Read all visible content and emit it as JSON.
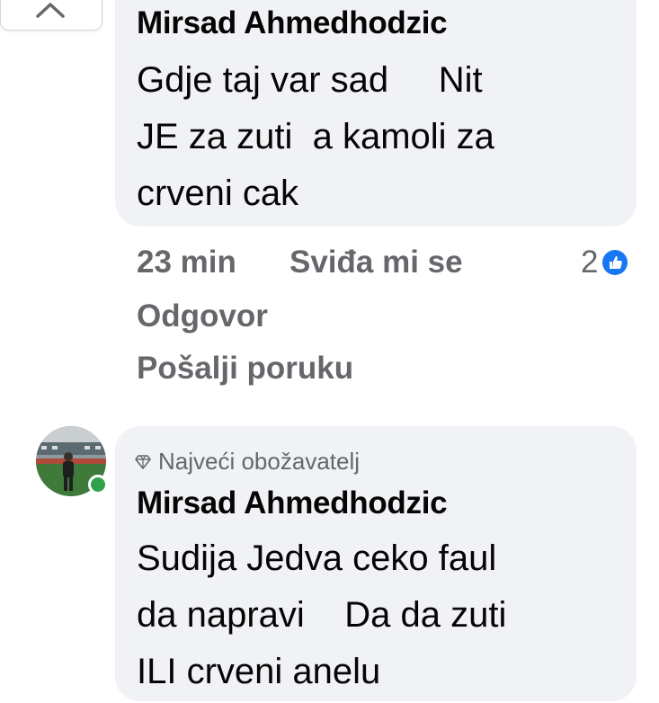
{
  "colors": {
    "bubble_bg": "#f0f2f5",
    "text_primary": "#050505",
    "text_secondary": "#65676b",
    "like_blue": "#1877f2",
    "online_green": "#31a24c"
  },
  "collapse_button": {
    "icon": "chevron-up-icon"
  },
  "comments": [
    {
      "author": "Mirsad Ahmedhodzic",
      "text_lines": [
        "Gdje taj var sad     Nit",
        "JE za zuti  a kamoli za",
        "crveni cak"
      ],
      "time": "23 min",
      "like_label": "Sviđa mi se",
      "reaction_count": "2",
      "reaction_icon": "like-icon",
      "reply_label": "Odgovor",
      "message_label": "Pošalji poruku"
    },
    {
      "badge": "Najveći obožavatelj",
      "badge_icon": "diamond-icon",
      "author": "Mirsad Ahmedhodzic",
      "avatar_icon": "avatar",
      "online": true,
      "text_lines": [
        "Sudija Jedva ceko faul",
        "da napravi    Da da zuti",
        "ILI crveni anelu"
      ]
    }
  ]
}
